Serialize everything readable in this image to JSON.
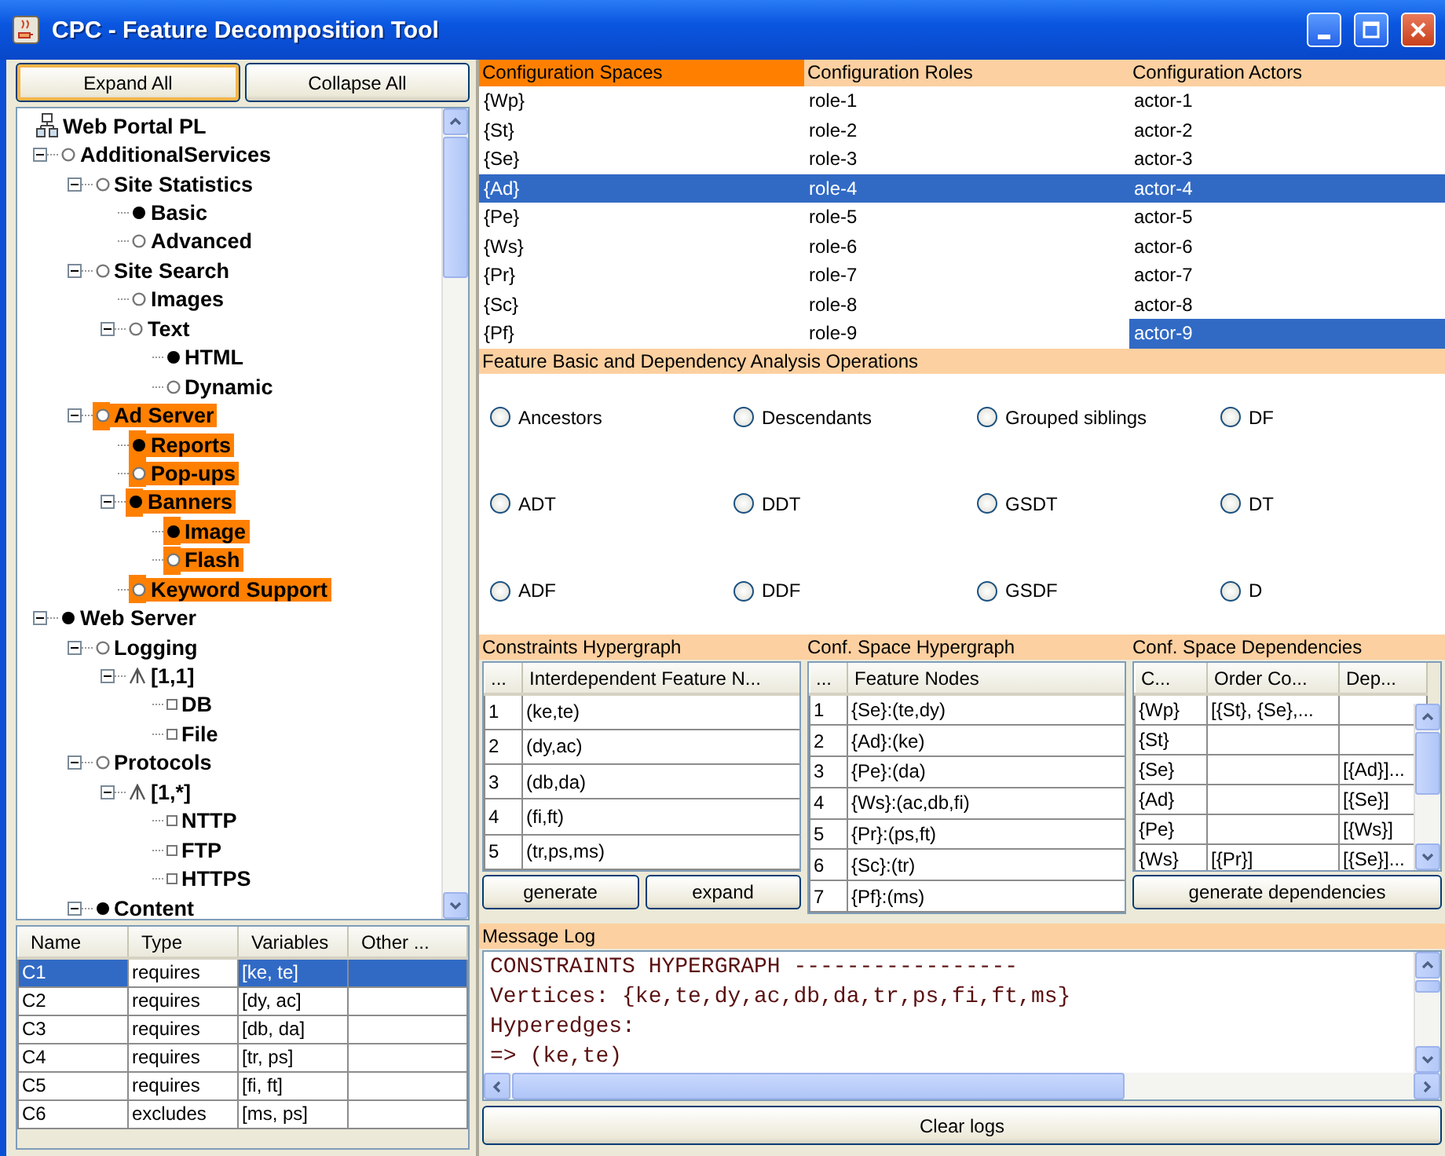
{
  "window": {
    "title": "CPC - Feature Decomposition Tool"
  },
  "tree_buttons": [
    {
      "label": "Expand All",
      "focused": true
    },
    {
      "label": "Collapse All",
      "focused": false
    }
  ],
  "tree": [
    {
      "label": "Web Portal PL",
      "kind": "root",
      "highlighted": false,
      "children": [
        {
          "label": "AdditionalServices",
          "kind": "optional",
          "highlighted": false,
          "expanded": true,
          "children": [
            {
              "label": "Site Statistics",
              "kind": "optional",
              "highlighted": false,
              "expanded": true,
              "children": [
                {
                  "label": "Basic",
                  "kind": "mandatory",
                  "highlighted": false
                },
                {
                  "label": "Advanced",
                  "kind": "optional",
                  "highlighted": false
                }
              ]
            },
            {
              "label": "Site Search",
              "kind": "optional",
              "highlighted": false,
              "expanded": true,
              "children": [
                {
                  "label": "Images",
                  "kind": "optional",
                  "highlighted": false
                },
                {
                  "label": "Text",
                  "kind": "optional",
                  "highlighted": false,
                  "expanded": true,
                  "children": [
                    {
                      "label": "HTML",
                      "kind": "mandatory",
                      "highlighted": false
                    },
                    {
                      "label": "Dynamic",
                      "kind": "optional",
                      "highlighted": false
                    }
                  ]
                }
              ]
            },
            {
              "label": "Ad Server",
              "kind": "optional",
              "highlighted": true,
              "expanded": true,
              "children": [
                {
                  "label": "Reports",
                  "kind": "mandatory",
                  "highlighted": true
                },
                {
                  "label": "Pop-ups",
                  "kind": "optional",
                  "highlighted": true
                },
                {
                  "label": "Banners",
                  "kind": "mandatory",
                  "highlighted": true,
                  "expanded": true,
                  "children": [
                    {
                      "label": "Image",
                      "kind": "mandatory",
                      "highlighted": true
                    },
                    {
                      "label": "Flash",
                      "kind": "optional",
                      "highlighted": true
                    }
                  ]
                },
                {
                  "label": "Keyword Support",
                  "kind": "optional",
                  "highlighted": true
                }
              ]
            }
          ]
        },
        {
          "label": "Web Server",
          "kind": "mandatory",
          "highlighted": false,
          "expanded": true,
          "children": [
            {
              "label": "Logging",
              "kind": "optional",
              "highlighted": false,
              "expanded": true,
              "children": [
                {
                  "label": "[1,1]",
                  "kind": "group",
                  "highlighted": false,
                  "expanded": true,
                  "children": [
                    {
                      "label": "DB",
                      "kind": "grouped",
                      "highlighted": false
                    },
                    {
                      "label": "File",
                      "kind": "grouped",
                      "highlighted": false
                    }
                  ]
                }
              ]
            },
            {
              "label": "Protocols",
              "kind": "optional",
              "highlighted": false,
              "expanded": true,
              "children": [
                {
                  "label": "[1,*]",
                  "kind": "group",
                  "highlighted": false,
                  "expanded": true,
                  "children": [
                    {
                      "label": "NTTP",
                      "kind": "grouped",
                      "highlighted": false
                    },
                    {
                      "label": "FTP",
                      "kind": "grouped",
                      "highlighted": false
                    },
                    {
                      "label": "HTTPS",
                      "kind": "grouped",
                      "highlighted": false
                    }
                  ]
                }
              ]
            },
            {
              "label": "Content",
              "kind": "mandatory",
              "highlighted": false,
              "expanded": true
            }
          ]
        }
      ]
    }
  ],
  "constraints_table": {
    "columns": [
      "Name",
      "Type",
      "Variables",
      "Other ..."
    ],
    "rows": [
      {
        "cells": [
          "C1",
          "requires",
          "[ke, te]"
        ],
        "selected": true
      },
      {
        "cells": [
          "C2",
          "requires",
          "[dy, ac]"
        ],
        "selected": false
      },
      {
        "cells": [
          "C3",
          "requires",
          "[db, da]"
        ],
        "selected": false
      },
      {
        "cells": [
          "C4",
          "requires",
          "[tr, ps]"
        ],
        "selected": false
      },
      {
        "cells": [
          "C5",
          "requires",
          "[fi, ft]"
        ],
        "selected": false
      },
      {
        "cells": [
          "C6",
          "excludes",
          "[ms, ps]"
        ],
        "selected": false
      }
    ]
  },
  "configuration": {
    "columns": [
      {
        "title": "Configuration Spaces",
        "selected": true,
        "cells": [
          {
            "text": "{Wp}",
            "selected": false
          },
          {
            "text": "{St}",
            "selected": false
          },
          {
            "text": "{Se}",
            "selected": false
          },
          {
            "text": "{Ad}",
            "selected": true
          },
          {
            "text": "{Pe}",
            "selected": false
          },
          {
            "text": "{Ws}",
            "selected": false
          },
          {
            "text": "{Pr}",
            "selected": false
          },
          {
            "text": "{Sc}",
            "selected": false
          },
          {
            "text": "{Pf}",
            "selected": false
          }
        ]
      },
      {
        "title": "Configuration Roles",
        "selected": false,
        "cells": [
          {
            "text": "role-1",
            "selected": false
          },
          {
            "text": "role-2",
            "selected": false
          },
          {
            "text": "role-3",
            "selected": false
          },
          {
            "text": "role-4",
            "selected": true
          },
          {
            "text": "role-5",
            "selected": false
          },
          {
            "text": "role-6",
            "selected": false
          },
          {
            "text": "role-7",
            "selected": false
          },
          {
            "text": "role-8",
            "selected": false
          },
          {
            "text": "role-9",
            "selected": false
          }
        ]
      },
      {
        "title": "Configuration Actors",
        "selected": false,
        "cells": [
          {
            "text": "actor-1",
            "selected": false
          },
          {
            "text": "actor-2",
            "selected": false
          },
          {
            "text": "actor-3",
            "selected": false
          },
          {
            "text": "actor-4",
            "selected": true
          },
          {
            "text": "actor-5",
            "selected": false
          },
          {
            "text": "actor-6",
            "selected": false
          },
          {
            "text": "actor-7",
            "selected": false
          },
          {
            "text": "actor-8",
            "selected": false
          },
          {
            "text": "actor-9",
            "selected": true
          }
        ]
      }
    ]
  },
  "operations": {
    "title": "Feature Basic and Dependency Analysis Operations",
    "options": [
      {
        "label": "Ancestors",
        "selected": false
      },
      {
        "label": "Descendants",
        "selected": false
      },
      {
        "label": "Grouped siblings",
        "selected": false
      },
      {
        "label": "DF",
        "selected": false
      },
      {
        "label": "ADT",
        "selected": false
      },
      {
        "label": "DDT",
        "selected": false
      },
      {
        "label": "GSDT",
        "selected": false
      },
      {
        "label": "DT",
        "selected": false
      },
      {
        "label": "ADF",
        "selected": false
      },
      {
        "label": "DDF",
        "selected": false
      },
      {
        "label": "GSDF",
        "selected": false
      },
      {
        "label": "D",
        "selected": false
      }
    ]
  },
  "constraints_hypergraph": {
    "title": "Constraints Hypergraph",
    "columns": [
      "...",
      "Interdependent Feature N..."
    ],
    "rows": [
      [
        "1",
        "(ke,te)"
      ],
      [
        "2",
        "(dy,ac)"
      ],
      [
        "3",
        "(db,da)"
      ],
      [
        "4",
        "(fi,ft)"
      ],
      [
        "5",
        "(tr,ps,ms)"
      ]
    ],
    "buttons": [
      "generate",
      "expand"
    ]
  },
  "space_hypergraph": {
    "title": "Conf. Space Hypergraph",
    "columns": [
      "...",
      "Feature Nodes"
    ],
    "rows": [
      [
        "1",
        "{Se}:(te,dy)"
      ],
      [
        "2",
        "{Ad}:(ke)"
      ],
      [
        "3",
        "{Pe}:(da)"
      ],
      [
        "4",
        "{Ws}:(ac,db,fi)"
      ],
      [
        "5",
        "{Pr}:(ps,ft)"
      ],
      [
        "6",
        "{Sc}:(tr)"
      ],
      [
        "7",
        "{Pf}:(ms)"
      ]
    ]
  },
  "space_dependencies": {
    "title": "Conf. Space Dependencies",
    "columns": [
      "C...",
      "Order Co...",
      "Dep..."
    ],
    "rows": [
      [
        "{Wp}",
        "[{St}, {Se},...",
        null
      ],
      [
        "{St}",
        null,
        null
      ],
      [
        "{Se}",
        null,
        "[{Ad}]..."
      ],
      [
        "{Ad}",
        null,
        "[{Se}]"
      ],
      [
        "{Pe}",
        null,
        "[{Ws}]"
      ],
      [
        "{Ws}",
        "[{Pr}]",
        "[{Se}]..."
      ]
    ],
    "button": "generate dependencies"
  },
  "message_log": {
    "title": "Message Log",
    "lines": [
      "CONSTRAINTS HYPERGRAPH -----------------",
      "Vertices: {ke,te,dy,ac,db,da,tr,ps,fi,ft,ms}",
      "Hyperedges:",
      "=> (ke,te)"
    ],
    "button": "Clear logs"
  }
}
